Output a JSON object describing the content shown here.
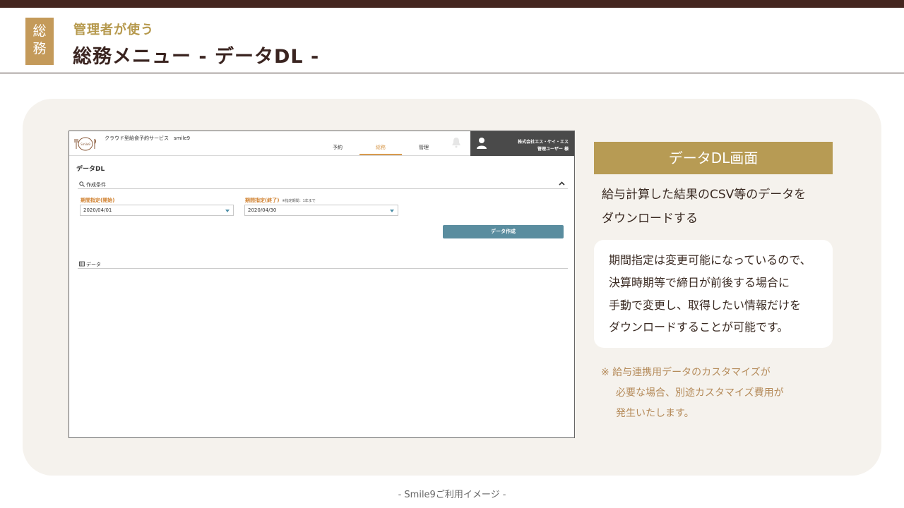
{
  "header": {
    "category_badge": "総\n務",
    "subtitle": "管理者が使う",
    "title": "総務メニュー - データDL -"
  },
  "app": {
    "logo_text": "Smile9",
    "service_name": "クラウド型給食予約サービス　smile9",
    "nav": [
      "予約",
      "総務",
      "管理"
    ],
    "active_nav": "総務",
    "company": "株式会社エス・ケイ・エス",
    "user": "管理ユーザー 様",
    "page_heading": "データDL",
    "conditions_label": "作成条件",
    "start_label": "期間指定(開始)",
    "end_label": "期間指定(終了)",
    "end_note": "※指定期間：1年まで",
    "start_value": "2020/04/01",
    "end_value": "2020/04/30",
    "create_button": "データ作成",
    "data_label": "データ"
  },
  "right": {
    "heading": "データDL画面",
    "desc_line1": "給与計算した結果のCSV等のデータを",
    "desc_line2": "ダウンロードする",
    "note_lines": [
      "期間指定は変更可能になっているので、",
      "決算時期等で締日が前後する場合に",
      "手動で変更し、取得したい情報だけを",
      "ダウンロードすることが可能です。"
    ],
    "custom_lines": [
      "※ 給与連携用データのカスタマイズが",
      "必要な場合、別途カスタマイズ費用が",
      "発生いたします。"
    ]
  },
  "footer": "- Smile9ご利用イメージ -",
  "colors": {
    "topbar": "#44261f",
    "badge": "#c49a5a",
    "accent_gold": "#b79b54",
    "panel_bg": "#f5f2ed",
    "button": "#5a8d9f",
    "active_tab": "#d89a4e"
  }
}
